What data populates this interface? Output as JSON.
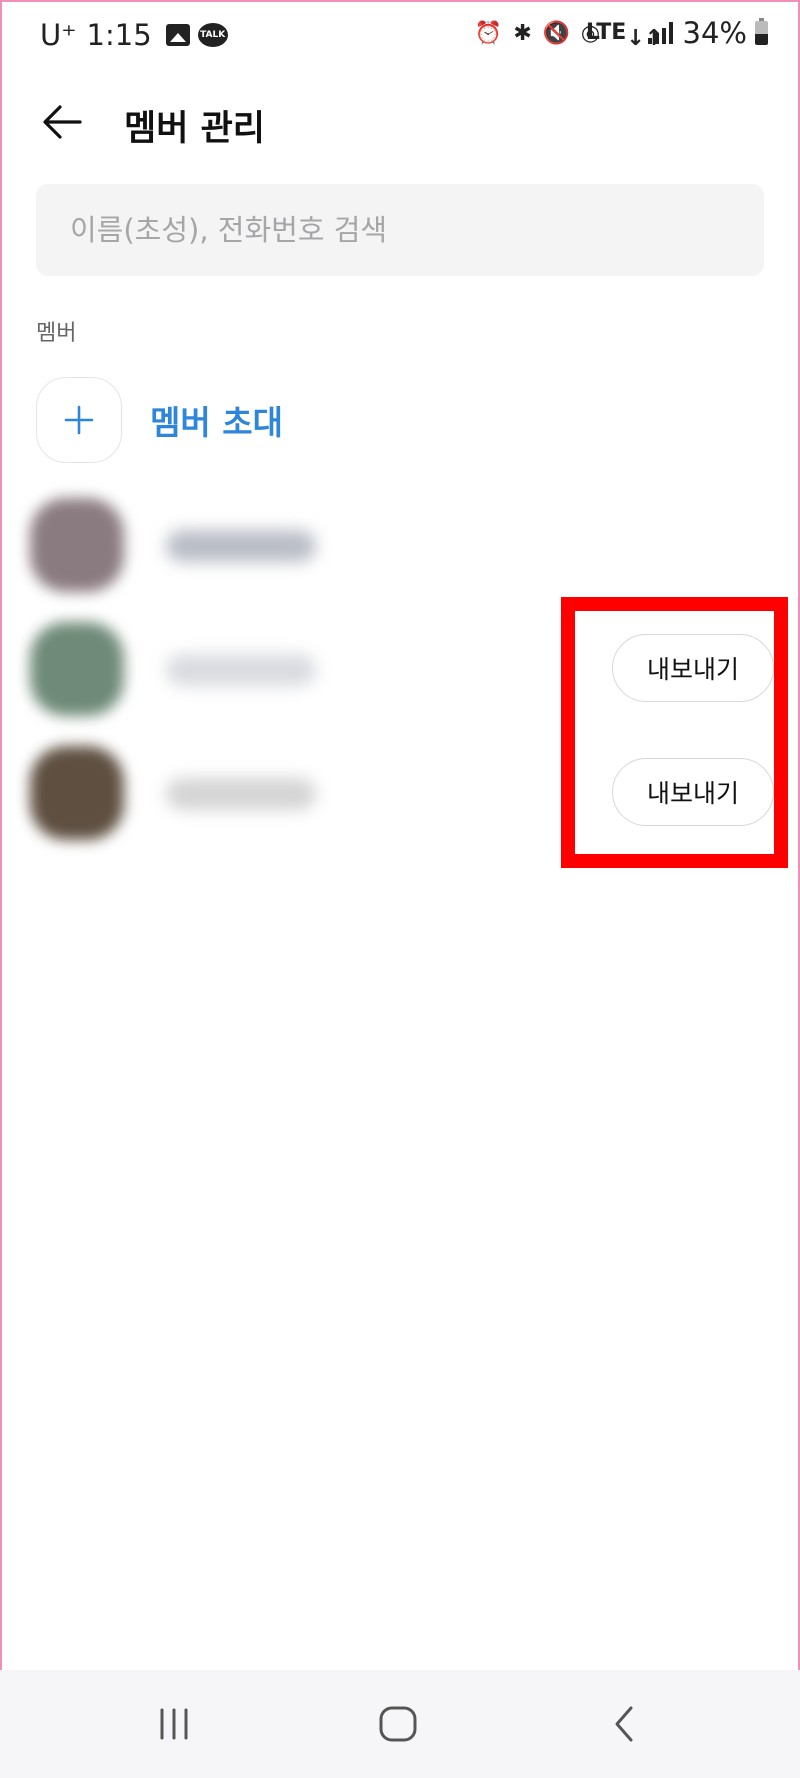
{
  "status_bar": {
    "carrier": "U⁺",
    "time": "1:15",
    "talk_badge": "TALK",
    "lte": "LTE",
    "battery": "34%"
  },
  "header": {
    "title": "멤버 관리"
  },
  "search": {
    "placeholder": "이름(초성), 전화번호 검색",
    "value": ""
  },
  "members_section": {
    "label": "멤버",
    "invite_label": "멤버 초대"
  },
  "members": [
    {
      "avatar_color": "#8a7b80",
      "name_color": "#b9bdc6",
      "export_label": ""
    },
    {
      "avatar_color": "#6f8a78",
      "name_color": "#d9dbe0",
      "export_label": "내보내기"
    },
    {
      "avatar_color": "#5e4f40",
      "name_color": "#d4d4d4",
      "export_label": "내보내기"
    }
  ],
  "colors": {
    "accent": "#2d86d9",
    "highlight": "#ff0000"
  },
  "nav": {
    "recent_icon": "recent-apps-icon",
    "home_icon": "home-icon",
    "back_icon": "back-icon"
  }
}
